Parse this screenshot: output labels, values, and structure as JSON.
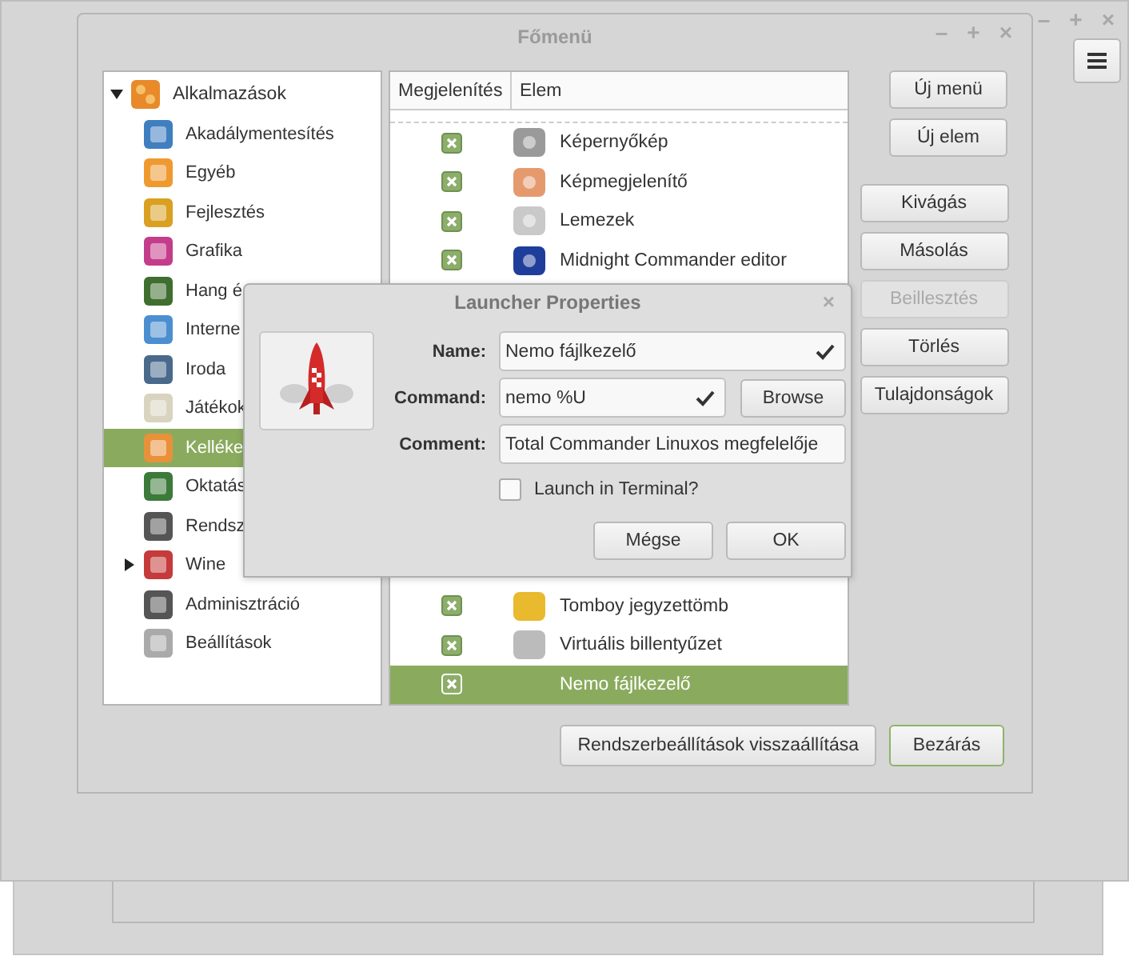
{
  "back_window": {
    "controls": [
      "–",
      "+",
      "×"
    ]
  },
  "window": {
    "title": "Főmenü",
    "controls": [
      "–",
      "+",
      "×"
    ]
  },
  "sidebar": {
    "items": [
      {
        "label": "Alkalmazások",
        "expanded": true,
        "selected": false,
        "children": [
          {
            "label": "Akadálymentesítés",
            "selected": false
          },
          {
            "label": "Egyéb",
            "selected": false
          },
          {
            "label": "Fejlesztés",
            "selected": false
          },
          {
            "label": "Grafika",
            "selected": false
          },
          {
            "label": "Hang é",
            "selected": false
          },
          {
            "label": "Interne",
            "selected": false
          },
          {
            "label": "Iroda",
            "selected": false
          },
          {
            "label": "Játékok",
            "selected": false
          },
          {
            "label": "Kelléke",
            "selected": true
          },
          {
            "label": "Oktatás",
            "selected": false
          },
          {
            "label": "Rendsz",
            "selected": false
          },
          {
            "label": "Wine",
            "selected": false,
            "expanded": false
          },
          {
            "label": "Adminisztráció",
            "selected": false
          },
          {
            "label": "Beállítások",
            "selected": false
          }
        ]
      }
    ]
  },
  "list": {
    "columns": [
      "Megjelenítés",
      "Elem"
    ],
    "upper_rows": [
      {
        "label": "Képernyőkép",
        "checked": true,
        "selected": false
      },
      {
        "label": "Képmegjelenítő",
        "checked": true,
        "selected": false
      },
      {
        "label": "Lemezek",
        "checked": true,
        "selected": false
      },
      {
        "label": "Midnight Commander editor",
        "checked": true,
        "selected": false
      }
    ],
    "lower_rows": [
      {
        "label": "Tomboy jegyzettömb",
        "checked": true,
        "selected": false
      },
      {
        "label": "Virtuális billentyűzet",
        "checked": true,
        "selected": false
      },
      {
        "label": "Nemo fájlkezelő",
        "checked": true,
        "selected": true
      }
    ]
  },
  "buttons": [
    {
      "label": "Új menü",
      "disabled": false,
      "kind": "narrow"
    },
    {
      "label": "Új elem",
      "disabled": false,
      "kind": "narrow"
    },
    {
      "label": "Kivágás",
      "disabled": false,
      "kind": "wide"
    },
    {
      "label": "Másolás",
      "disabled": false,
      "kind": "wide"
    },
    {
      "label": "Beillesztés",
      "disabled": true,
      "kind": "wide"
    },
    {
      "label": "Törlés",
      "disabled": false,
      "kind": "wide"
    },
    {
      "label": "Tulajdonságok",
      "disabled": false,
      "kind": "wide"
    }
  ],
  "footer_buttons": [
    {
      "label": "Rendszerbeállítások visszaállítása",
      "focused": false
    },
    {
      "label": "Bezárás",
      "focused": true
    }
  ],
  "dialog": {
    "title": "Launcher Properties",
    "close": "×",
    "fields": [
      {
        "label": "Name:",
        "value": "Nemo fájlkezelő",
        "valid": true
      },
      {
        "label": "Command:",
        "value": "nemo %U",
        "valid": true,
        "button": "Browse"
      },
      {
        "label": "Comment:",
        "value": "Total Commander Linuxos megfelelője"
      }
    ],
    "terminal": {
      "label": "Launch in Terminal?",
      "checked": false
    },
    "buttons": [
      "Mégse",
      "OK"
    ]
  }
}
